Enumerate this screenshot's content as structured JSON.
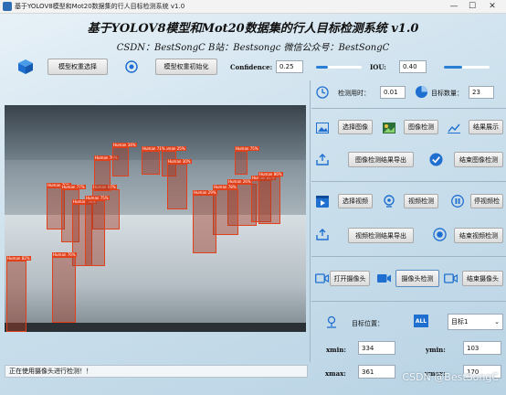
{
  "window": {
    "title": "基于YOLOV8模型和Mot20数据集的行人目标检测系统 v1.0",
    "minimize": "—",
    "maximize": "☐",
    "close": "✕"
  },
  "header": {
    "title": "基于YOLOV8模型和Mot20数据集的行人目标检测系统 v1.0",
    "subtitle": "CSDN：BestSongC   B站：Bestsongc   微信公众号：BestSongC"
  },
  "toolbar": {
    "select_weights": "模型权重选择",
    "init_weights": "模型权重初始化",
    "confidence_label": "Confidence:",
    "confidence_value": "0.25",
    "confidence_level": 0.25,
    "iou_label": "IOU:",
    "iou_value": "0.40",
    "iou_level": 0.4
  },
  "stats": {
    "time_label": "检测用时：",
    "time_value": "0.01",
    "count_label": "目标数量：",
    "count_value": "23"
  },
  "image_section": {
    "select_image": "选择图像",
    "detect_image": "图像检测",
    "show_result": "结果展示",
    "export_image": "图像检测结果导出",
    "stop_image": "结束图像检测"
  },
  "video_section": {
    "select_video": "选择视频",
    "detect_video": "视频检测",
    "pause_video": "停视频检",
    "export_video": "视频检测结果导出",
    "stop_video": "结束视频检测"
  },
  "camera_section": {
    "open_camera": "打开摄像头",
    "detect_camera": "摄像头检测",
    "stop_camera": "结束摄像头"
  },
  "target": {
    "position_label": "目标位置：",
    "all_badge": "ALL",
    "selected_target": "目标1",
    "xmin_label": "xmin:",
    "xmin_value": "334",
    "ymin_label": "ymin:",
    "ymin_value": "103",
    "xmax_label": "xmax:",
    "xmax_value": "361",
    "ymax_label": "ymax:",
    "ymax_value": "170"
  },
  "status": {
    "text": "正在使用摄像头进行检测！！"
  },
  "watermark": "CSDN @BestSongC",
  "colors": {
    "accent": "#2a7fd5",
    "bbox": "#e0401a",
    "icon_blue": "#1f6fd0"
  },
  "detections": [
    {
      "label": "Human 82%"
    },
    {
      "label": "Human 25%"
    },
    {
      "label": "Human 75%"
    },
    {
      "label": "Human 79%"
    },
    {
      "label": "Human 77%"
    },
    {
      "label": "Human 87%"
    },
    {
      "label": "Human 78%"
    },
    {
      "label": "Human 75%"
    },
    {
      "label": "Human 26%"
    },
    {
      "label": "Human 78%"
    },
    {
      "label": "Human 81%"
    },
    {
      "label": "Human 86%"
    },
    {
      "label": "Human 30%"
    },
    {
      "label": "Human 70%"
    },
    {
      "label": "Human 34%"
    },
    {
      "label": "Human 71%"
    },
    {
      "label": "Human 29%"
    },
    {
      "label": "Human 76%"
    }
  ]
}
